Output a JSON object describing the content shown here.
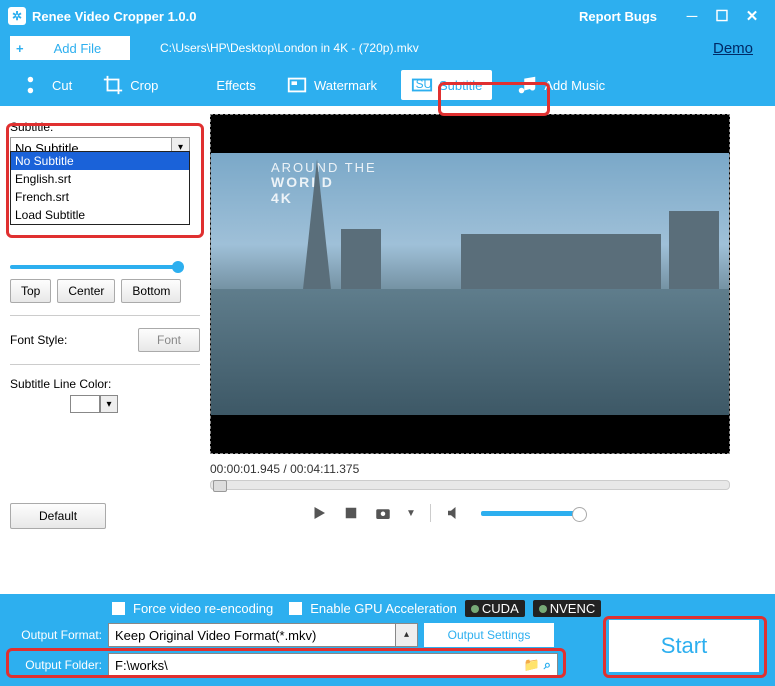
{
  "title": "Renee Video Cropper 1.0.0",
  "report": "Report Bugs",
  "addfile": "Add File",
  "filepath": "C:\\Users\\HP\\Desktop\\London in 4K - (720p).mkv",
  "demo": "Demo",
  "tabs": {
    "cut": "Cut",
    "crop": "Crop",
    "effects": "Effects",
    "watermark": "Watermark",
    "subtitle": "Subtitle",
    "addmusic": "Add Music"
  },
  "left": {
    "subtitle_label": "Subtitle:",
    "subtitle_value": "No Subtitle",
    "options": [
      "No Subtitle",
      "English.srt",
      "French.srt",
      "Load Subtitle"
    ],
    "pos": {
      "top": "Top",
      "center": "Center",
      "bottom": "Bottom"
    },
    "fontstyle": "Font Style:",
    "fontbtn": "Font",
    "linecolor": "Subtitle Line Color:",
    "default": "Default"
  },
  "preview": {
    "timetext": "00:00:01.945 / 00:04:11.375",
    "overlay1": "AROUND THE",
    "overlay2": "WORLD",
    "overlay3": "4K"
  },
  "bottom": {
    "force": "Force video re-encoding",
    "gpu": "Enable GPU Acceleration",
    "cuda": "CUDA",
    "nvenc": "NVENC",
    "outformat_label": "Output Format:",
    "outformat": "Keep Original Video Format(*.mkv)",
    "outsettings": "Output Settings",
    "outfolder_label": "Output Folder:",
    "outfolder": "F:\\works\\",
    "start": "Start"
  }
}
